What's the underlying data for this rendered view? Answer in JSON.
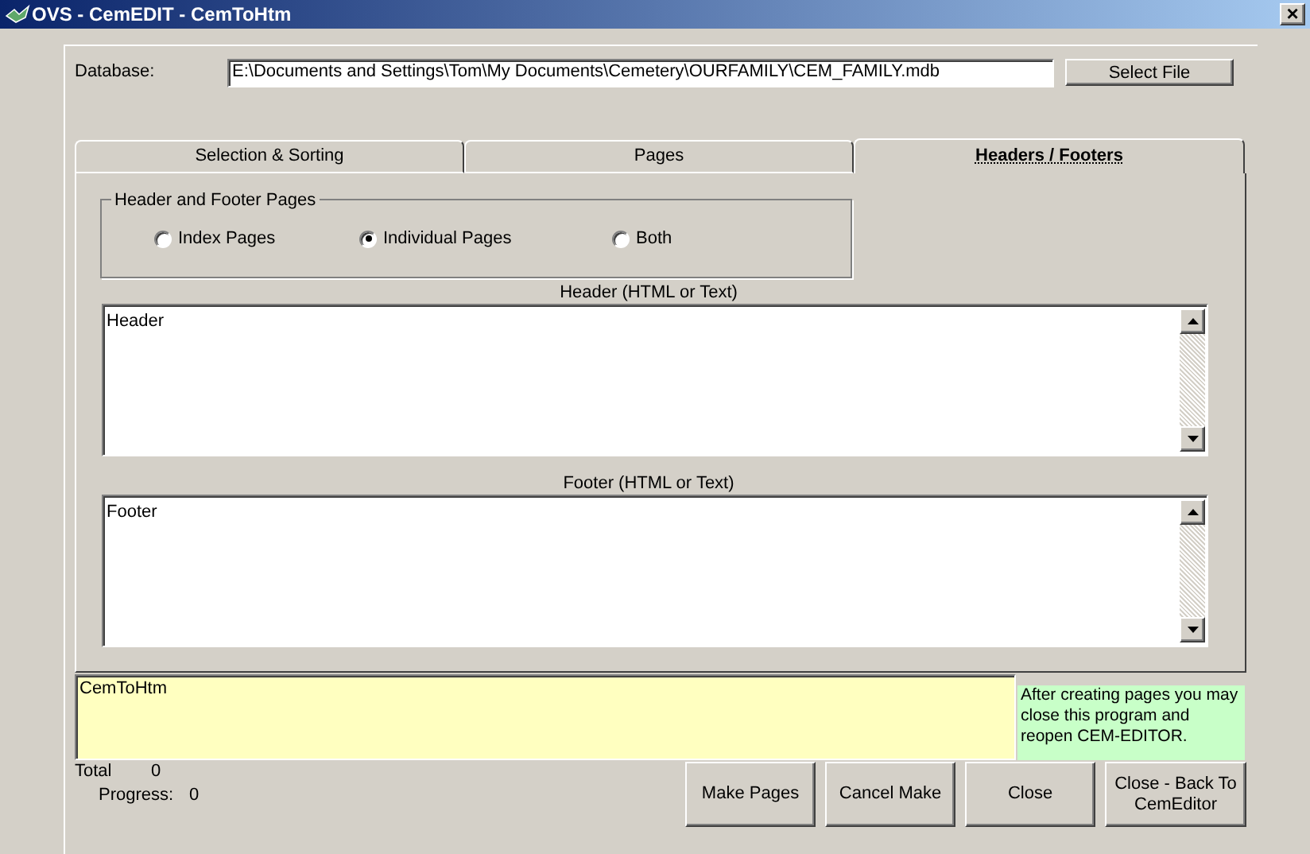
{
  "window": {
    "title": "OVS - CemEDIT - CemToHtm",
    "close": "×"
  },
  "database": {
    "label": "Database:",
    "value": "E:\\Documents and Settings\\Tom\\My Documents\\Cemetery\\OURFAMILY\\CEM_FAMILY.mdb",
    "button": "Select File"
  },
  "tabs": [
    {
      "label": "Selection & Sorting",
      "selected": false
    },
    {
      "label": "Pages",
      "selected": false
    },
    {
      "label": "Headers / Footers",
      "selected": true
    }
  ],
  "header_footer_pages": {
    "title": "Header and Footer Pages",
    "options": [
      {
        "label": "Index Pages",
        "selected": false
      },
      {
        "label": "Individual Pages",
        "selected": true
      },
      {
        "label": "Both",
        "selected": false
      }
    ]
  },
  "header": {
    "label": "Header (HTML or Text)",
    "value": "Header"
  },
  "footer": {
    "label": "Footer (HTML or Text)",
    "value": "Footer"
  },
  "log": {
    "text": "CemToHtm"
  },
  "note": "After creating pages you may close this program and reopen CEM-EDITOR.",
  "status": {
    "total_label": "Total",
    "total": "0",
    "progress_label": "Progress:",
    "progress": "0"
  },
  "buttons": [
    "Make Pages",
    "Cancel Make",
    "Close",
    "Close - Back To CemEditor"
  ]
}
